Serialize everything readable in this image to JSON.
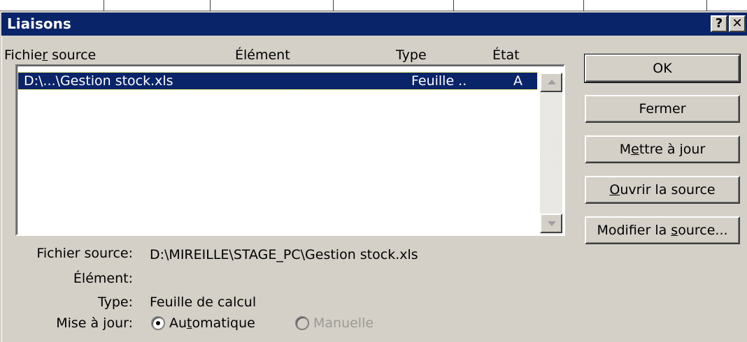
{
  "dialog": {
    "title": "Liaisons",
    "help_button": "?",
    "close_button": "✕"
  },
  "columns": {
    "source_pre": "Fichie",
    "source_key": "r",
    "source_post": " source",
    "element": "Élément",
    "type": "Type",
    "state": "État"
  },
  "links": [
    {
      "source": "D:\\...\\Gestion stock.xls",
      "element": "",
      "type": "Feuille ..",
      "state": "A",
      "selected": true
    }
  ],
  "buttons": {
    "ok": "OK",
    "close": "Fermer",
    "update_pre": "M",
    "update_key": "e",
    "update_post": "ttre à jour",
    "open_key": "O",
    "open_post": "uvrir la source",
    "change_pre": "Modifier la ",
    "change_key": "s",
    "change_post": "ource..."
  },
  "details": {
    "source_label": "Fichier source:",
    "source_value": "D:\\MIREILLE\\STAGE_PC\\Gestion stock.xls",
    "element_label": "Élément:",
    "element_value": "",
    "type_label": "Type:",
    "type_value": "Feuille de calcul",
    "update_label": "Mise à jour:",
    "auto_pre": "Au",
    "auto_key": "t",
    "auto_post": "omatique",
    "manual": "Manuelle",
    "update_mode": "Automatique"
  },
  "colors": {
    "titlebar": "#0a246a",
    "face": "#d4d0c8",
    "selection": "#0a246a"
  }
}
